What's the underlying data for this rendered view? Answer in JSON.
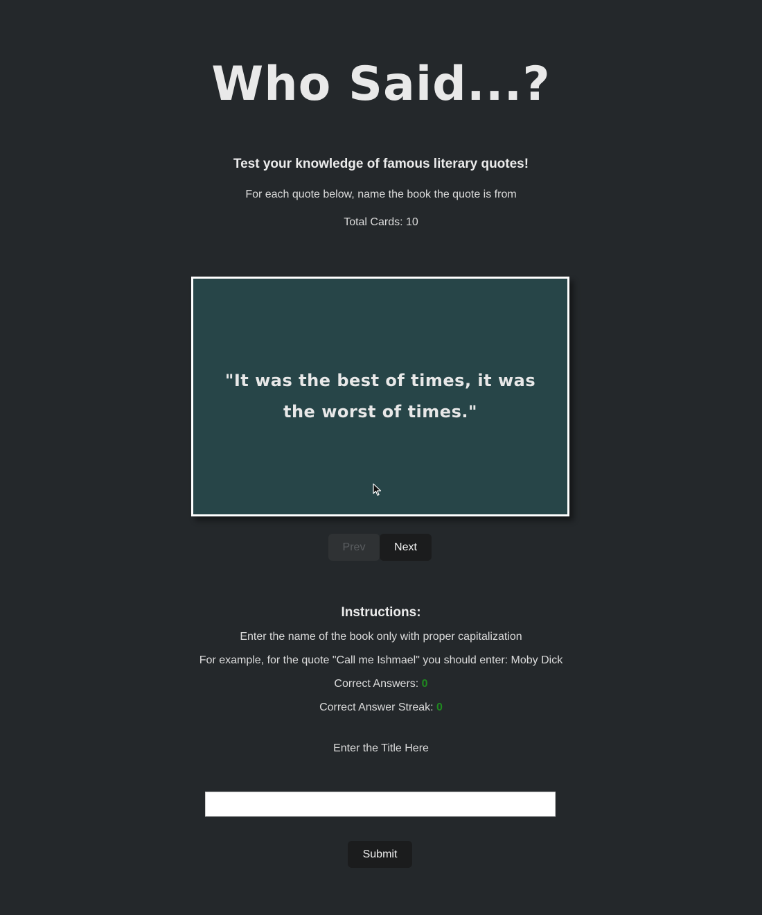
{
  "header": {
    "title": "Who Said...?",
    "tagline": "Test your knowledge of famous literary quotes!",
    "subtext": "For each quote below, name the book the quote is from",
    "total_label": "Total Cards: 10"
  },
  "card": {
    "quote": "\"It was the best of times, it was the worst of times.\""
  },
  "nav": {
    "prev_label": "Prev",
    "next_label": "Next"
  },
  "instructions": {
    "heading": "Instructions:",
    "line1": "Enter the name of the book only with proper capitalization",
    "line2": "For example, for the quote \"Call me Ishmael\" you should enter: Moby Dick"
  },
  "stats": {
    "correct_label": "Correct Answers: ",
    "correct_value": "0",
    "streak_label": "Correct Answer Streak: ",
    "streak_value": "0"
  },
  "form": {
    "field_label": "Enter the Title Here",
    "input_value": "",
    "submit_label": "Submit"
  },
  "colors": {
    "background": "#24282b",
    "card": "#274548",
    "counter_green": "#1f8a1f"
  }
}
